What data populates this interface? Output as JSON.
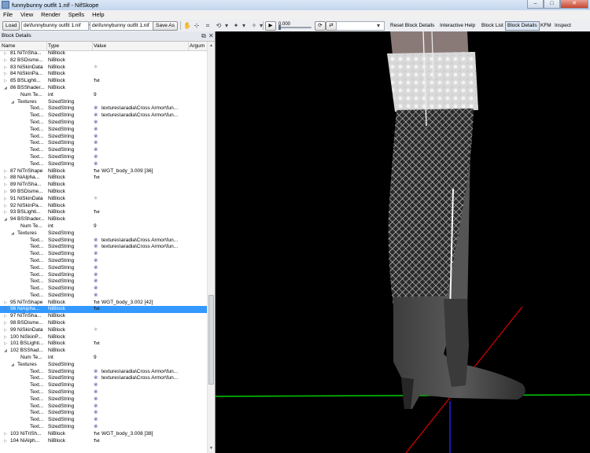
{
  "window": {
    "title": "funnybunny outfit 1.nif - NifSkope",
    "controls": [
      "–",
      "□",
      "✕"
    ]
  },
  "menu": [
    "File",
    "View",
    "Render",
    "Spells",
    "Help"
  ],
  "toolbar": {
    "load_label": "Load",
    "load_path": "de\\funnybunny outfit 1.nif",
    "save_path": "de\\funnybunny outfit 1.nif",
    "save_as_label": "Save As",
    "frame_value": "0.000",
    "links": [
      "Reset Block Details",
      "Interactive Help",
      "Block List",
      "Block Details",
      "KFM",
      "Inspect"
    ],
    "active_link": "Block Details"
  },
  "panel": {
    "title": "Block Details",
    "columns": [
      "Name",
      "Type",
      "Value",
      "Argum"
    ],
    "rows": [
      {
        "indent": 0,
        "exp": "▷",
        "name": "81 NiTriSha...",
        "type": "NiBlock",
        "icon": "",
        "value": ""
      },
      {
        "indent": 0,
        "exp": "▷",
        "name": "82 BSDisme...",
        "type": "NiBlock",
        "icon": "",
        "value": ""
      },
      {
        "indent": 0,
        "exp": "▷",
        "name": "83 NiSkinData",
        "type": "NiBlock",
        "icon": "link",
        "value": ""
      },
      {
        "indent": 0,
        "exp": "▷",
        "name": "84 NiSkinPa...",
        "type": "NiBlock",
        "icon": "",
        "value": ""
      },
      {
        "indent": 0,
        "exp": "▷",
        "name": "85 BSLighti...",
        "type": "NiBlock",
        "icon": "txt",
        "value": ""
      },
      {
        "indent": 0,
        "exp": "◢",
        "name": "86 BSShader...",
        "type": "NiBlock",
        "icon": "",
        "value": ""
      },
      {
        "indent": 2,
        "exp": "",
        "name": "Num Te...",
        "type": "int",
        "icon": "",
        "value": "9"
      },
      {
        "indent": 1,
        "exp": "◢",
        "name": "Textures",
        "type": "SizedString",
        "icon": "",
        "value": ""
      },
      {
        "indent": 3,
        "exp": "",
        "name": "Text...",
        "type": "SizedString",
        "icon": "ic",
        "value": "textures\\aradia\\Cross Armor\\fun..."
      },
      {
        "indent": 3,
        "exp": "",
        "name": "Text...",
        "type": "SizedString",
        "icon": "ic",
        "value": "textures\\aradia\\Cross Armor\\fun..."
      },
      {
        "indent": 3,
        "exp": "",
        "name": "Text...",
        "type": "SizedString",
        "icon": "ic",
        "value": ""
      },
      {
        "indent": 3,
        "exp": "",
        "name": "Text...",
        "type": "SizedString",
        "icon": "ic",
        "value": ""
      },
      {
        "indent": 3,
        "exp": "",
        "name": "Text...",
        "type": "SizedString",
        "icon": "ic",
        "value": ""
      },
      {
        "indent": 3,
        "exp": "",
        "name": "Text...",
        "type": "SizedString",
        "icon": "ic",
        "value": ""
      },
      {
        "indent": 3,
        "exp": "",
        "name": "Text...",
        "type": "SizedString",
        "icon": "ic",
        "value": ""
      },
      {
        "indent": 3,
        "exp": "",
        "name": "Text...",
        "type": "SizedString",
        "icon": "ic",
        "value": ""
      },
      {
        "indent": 3,
        "exp": "",
        "name": "Text...",
        "type": "SizedString",
        "icon": "ic",
        "value": ""
      },
      {
        "indent": 0,
        "exp": "▷",
        "name": "87 NiTriShape",
        "type": "NiBlock",
        "icon": "txt",
        "value": "WGT_body_3.009 [36]"
      },
      {
        "indent": 0,
        "exp": "▷",
        "name": "88 NiAlpha...",
        "type": "NiBlock",
        "icon": "txt",
        "value": ""
      },
      {
        "indent": 0,
        "exp": "▷",
        "name": "89 NiTriSha...",
        "type": "NiBlock",
        "icon": "",
        "value": ""
      },
      {
        "indent": 0,
        "exp": "▷",
        "name": "90 BSDisme...",
        "type": "NiBlock",
        "icon": "",
        "value": ""
      },
      {
        "indent": 0,
        "exp": "▷",
        "name": "91 NiSkinData",
        "type": "NiBlock",
        "icon": "link",
        "value": ""
      },
      {
        "indent": 0,
        "exp": "▷",
        "name": "92 NiSkinPa...",
        "type": "NiBlock",
        "icon": "",
        "value": ""
      },
      {
        "indent": 0,
        "exp": "▷",
        "name": "93 BSLighti...",
        "type": "NiBlock",
        "icon": "txt",
        "value": ""
      },
      {
        "indent": 0,
        "exp": "◢",
        "name": "94 BSShader...",
        "type": "NiBlock",
        "icon": "",
        "value": ""
      },
      {
        "indent": 2,
        "exp": "",
        "name": "Num Te...",
        "type": "int",
        "icon": "",
        "value": "9"
      },
      {
        "indent": 1,
        "exp": "◢",
        "name": "Textures",
        "type": "SizedString",
        "icon": "",
        "value": ""
      },
      {
        "indent": 3,
        "exp": "",
        "name": "Text...",
        "type": "SizedString",
        "icon": "ic",
        "value": "textures\\aradia\\Cross Armor\\fun..."
      },
      {
        "indent": 3,
        "exp": "",
        "name": "Text...",
        "type": "SizedString",
        "icon": "ic",
        "value": "textures\\aradia\\Cross Armor\\fun..."
      },
      {
        "indent": 3,
        "exp": "",
        "name": "Text...",
        "type": "SizedString",
        "icon": "ic",
        "value": ""
      },
      {
        "indent": 3,
        "exp": "",
        "name": "Text...",
        "type": "SizedString",
        "icon": "ic",
        "value": ""
      },
      {
        "indent": 3,
        "exp": "",
        "name": "Text...",
        "type": "SizedString",
        "icon": "ic",
        "value": ""
      },
      {
        "indent": 3,
        "exp": "",
        "name": "Text...",
        "type": "SizedString",
        "icon": "ic",
        "value": ""
      },
      {
        "indent": 3,
        "exp": "",
        "name": "Text...",
        "type": "SizedString",
        "icon": "ic",
        "value": ""
      },
      {
        "indent": 3,
        "exp": "",
        "name": "Text...",
        "type": "SizedString",
        "icon": "ic",
        "value": ""
      },
      {
        "indent": 3,
        "exp": "",
        "name": "Text...",
        "type": "SizedString",
        "icon": "ic",
        "value": ""
      },
      {
        "indent": 0,
        "exp": "▷",
        "name": "95 NiTriShape",
        "type": "NiBlock",
        "icon": "txt",
        "value": "WGT_body_3.002 [42]"
      },
      {
        "indent": 0,
        "exp": "▷",
        "name": "96 NiAlpha...",
        "type": "NiBlock",
        "icon": "txt",
        "value": "",
        "selected": true
      },
      {
        "indent": 0,
        "exp": "▷",
        "name": "97 NiTriSha...",
        "type": "NiBlock",
        "icon": "",
        "value": ""
      },
      {
        "indent": 0,
        "exp": "▷",
        "name": "98 BSDisme...",
        "type": "NiBlock",
        "icon": "",
        "value": ""
      },
      {
        "indent": 0,
        "exp": "▷",
        "name": "99 NiSkinData",
        "type": "NiBlock",
        "icon": "link",
        "value": ""
      },
      {
        "indent": 0,
        "exp": "▷",
        "name": "100 NiSkinP...",
        "type": "NiBlock",
        "icon": "",
        "value": ""
      },
      {
        "indent": 0,
        "exp": "▷",
        "name": "101 BSLighti...",
        "type": "NiBlock",
        "icon": "txt",
        "value": ""
      },
      {
        "indent": 0,
        "exp": "◢",
        "name": "102 BSShad...",
        "type": "NiBlock",
        "icon": "",
        "value": ""
      },
      {
        "indent": 2,
        "exp": "",
        "name": "Num Te...",
        "type": "int",
        "icon": "",
        "value": "9"
      },
      {
        "indent": 1,
        "exp": "◢",
        "name": "Textures",
        "type": "SizedString",
        "icon": "",
        "value": ""
      },
      {
        "indent": 3,
        "exp": "",
        "name": "Text...",
        "type": "SizedString",
        "icon": "ic",
        "value": "textures\\aradia\\Cross Armor\\fun..."
      },
      {
        "indent": 3,
        "exp": "",
        "name": "Text...",
        "type": "SizedString",
        "icon": "ic",
        "value": "textures\\aradia\\Cross Armor\\fun..."
      },
      {
        "indent": 3,
        "exp": "",
        "name": "Text...",
        "type": "SizedString",
        "icon": "ic",
        "value": ""
      },
      {
        "indent": 3,
        "exp": "",
        "name": "Text...",
        "type": "SizedString",
        "icon": "ic",
        "value": ""
      },
      {
        "indent": 3,
        "exp": "",
        "name": "Text...",
        "type": "SizedString",
        "icon": "ic",
        "value": ""
      },
      {
        "indent": 3,
        "exp": "",
        "name": "Text...",
        "type": "SizedString",
        "icon": "ic",
        "value": ""
      },
      {
        "indent": 3,
        "exp": "",
        "name": "Text...",
        "type": "SizedString",
        "icon": "ic",
        "value": ""
      },
      {
        "indent": 3,
        "exp": "",
        "name": "Text...",
        "type": "SizedString",
        "icon": "ic",
        "value": ""
      },
      {
        "indent": 3,
        "exp": "",
        "name": "Text...",
        "type": "SizedString",
        "icon": "ic",
        "value": ""
      },
      {
        "indent": 0,
        "exp": "▷",
        "name": "103 NiTriSh...",
        "type": "NiBlock",
        "icon": "txt",
        "value": "WGT_body_3.008 [38]"
      },
      {
        "indent": 0,
        "exp": "▷",
        "name": "104 NiAlph...",
        "type": "NiBlock",
        "icon": "txt",
        "value": ""
      }
    ]
  },
  "icons": {
    "txt": "Txt",
    "ic": "❀",
    "link": "✳"
  },
  "colors": {
    "selection": "#3399ff",
    "axis_green": "#00cc00",
    "axis_red": "#dd0000",
    "axis_blue": "#2222ee",
    "viewport_bg": "#000000"
  }
}
